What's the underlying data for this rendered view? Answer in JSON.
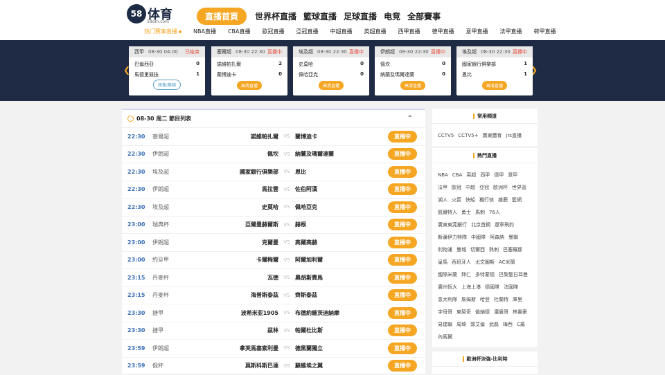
{
  "brand": {
    "logo_num": "58",
    "logo_text": "体育",
    "logo_sub": "58dm.com"
  },
  "nav": {
    "home": "直播首頁",
    "links": [
      "世界杯直播",
      "籃球直播",
      "足球直播",
      "电竞",
      "全部賽事"
    ],
    "sub_links": [
      "热门赛事直播",
      "NBA直播",
      "CBA直播",
      "歐冠直播",
      "亞冠直播",
      "中超直播",
      "英超直播",
      "西甲直播",
      "德甲直播",
      "意甲直播",
      "法甲直播",
      "荷甲直播"
    ]
  },
  "live_cards": [
    {
      "league": "西甲",
      "time": "08-30 04:00",
      "status": "已結束",
      "home": "巴倫西亞",
      "home_score": "0",
      "away": "馬德里競技",
      "away_score": "1",
      "button": "錄像/集錦"
    },
    {
      "league": "塞爾超",
      "time": "08-30 22:30",
      "status": "直播中",
      "home": "諾維帕扎爾",
      "home_score": "2",
      "away": "蘭博迪卡",
      "away_score": "0",
      "button": "高清直播"
    },
    {
      "league": "埃及超",
      "time": "08-30 22:30",
      "status": "直播中",
      "home": "史莫哈",
      "home_score": "0",
      "away": "佩哈亞克",
      "away_score": "0",
      "button": "高清直播"
    },
    {
      "league": "伊朗超",
      "time": "08-30 22:30",
      "status": "直播中",
      "home": "佩坎",
      "home_score": "0",
      "away": "納蘭及瑪爾達蘭",
      "away_score": "0",
      "button": "高清直播"
    },
    {
      "league": "埃及超",
      "time": "08-30 22:30",
      "status": "直播中",
      "home": "國家銀行俱樂部",
      "home_score": "1",
      "away": "恩比",
      "away_score": "1",
      "button": "高清直播"
    }
  ],
  "list": {
    "title": "08-30 周二 節目列表",
    "collapse_icon": "⌃",
    "vs": "VS",
    "rows": [
      {
        "time": "22:30",
        "league": "塞爾超",
        "home": "諾維帕扎爾",
        "away": "蘭博迪卡",
        "btn": "直播中"
      },
      {
        "time": "22:30",
        "league": "伊朗超",
        "home": "佩坎",
        "away": "納蘭及瑪爾達蘭",
        "btn": "直播中"
      },
      {
        "time": "22:30",
        "league": "埃及超",
        "home": "國家銀行俱樂部",
        "away": "恩比",
        "btn": "直播中"
      },
      {
        "time": "22:30",
        "league": "伊朗超",
        "home": "馬拉雲",
        "away": "佐伯阿漢",
        "btn": "直播中"
      },
      {
        "time": "22:30",
        "league": "埃及超",
        "home": "史莫哈",
        "away": "佩哈亞克",
        "btn": "直播中"
      },
      {
        "time": "23:00",
        "league": "瑞典杯",
        "home": "亞爾曼赫爾斯",
        "away": "赫根",
        "btn": "直播中"
      },
      {
        "time": "23:00",
        "league": "伊朗超",
        "home": "克爾曼",
        "away": "高爾高赫",
        "btn": "直播中"
      },
      {
        "time": "23:00",
        "league": "約旦甲",
        "home": "卡爾梅爾",
        "away": "阿爾加利爾",
        "btn": "直播中"
      },
      {
        "time": "23:15",
        "league": "丹麥杯",
        "home": "瓦德",
        "away": "奧胡斯費馬",
        "btn": "直播中"
      },
      {
        "time": "23:15",
        "league": "丹麥杯",
        "home": "海普斯泰茲",
        "away": "齊斯泰茲",
        "btn": "直播中"
      },
      {
        "time": "23:30",
        "league": "捷甲",
        "home": "波希米亚1905",
        "away": "布德約維茨迪納摩",
        "btn": "直播中"
      },
      {
        "time": "23:30",
        "league": "捷甲",
        "home": "茲林",
        "away": "帕爾杜比斯",
        "btn": "直播中"
      },
      {
        "time": "23:59",
        "league": "伊朗超",
        "home": "拿芙馬塞索利曼",
        "away": "德黑蘭獨立",
        "btn": "直播中"
      },
      {
        "time": "23:59",
        "league": "俄杯",
        "home": "莫斯科斯巴達",
        "away": "蘇維埃之翼",
        "btn": "直播中"
      }
    ]
  },
  "sidebar": {
    "common_title": "常用頻道",
    "common_tags": [
      "CCTV5",
      "CCTV5+",
      "廣東體育",
      "jrs直播"
    ],
    "hot_title": "熱門直播",
    "hot_tags": [
      "NBA",
      "CBA",
      "英超",
      "西甲",
      "德甲",
      "意甲",
      "法甲",
      "歐冠",
      "中超",
      "亞冠",
      "歐洲杯",
      "世界盃",
      "湖人",
      "火箭",
      "快船",
      "獨行俠",
      "雄鹿",
      "籃網",
      "凱爾特人",
      "勇士",
      "馬刺",
      "76人",
      "廣東東莞銀行",
      "北京首鋼",
      "遼寧飛豹",
      "新疆伊力特隊",
      "中國隊",
      "阿森納",
      "曼聯",
      "利物浦",
      "曼城",
      "切爾西",
      "熱刺",
      "巴塞羅那",
      "皇馬",
      "西班牙人",
      "尤文圖斯",
      "AC米蘭",
      "國際米蘭",
      "拜仁",
      "多特蒙德",
      "巴黎聖日耳曼",
      "廣州恆大",
      "上海上港",
      "德國隊",
      "法國隊",
      "意大利隊",
      "詹姆斯",
      "哈登",
      "杜蘭特",
      "庫里",
      "字母哥",
      "東契奇",
      "倫納德",
      "濃眉哥",
      "林書豪",
      "易建聯",
      "周琦",
      "郭艾倫",
      "武磊",
      "梅西",
      "C羅",
      "內馬爾"
    ],
    "euro_title": "歐洲杯決強-比利時"
  }
}
